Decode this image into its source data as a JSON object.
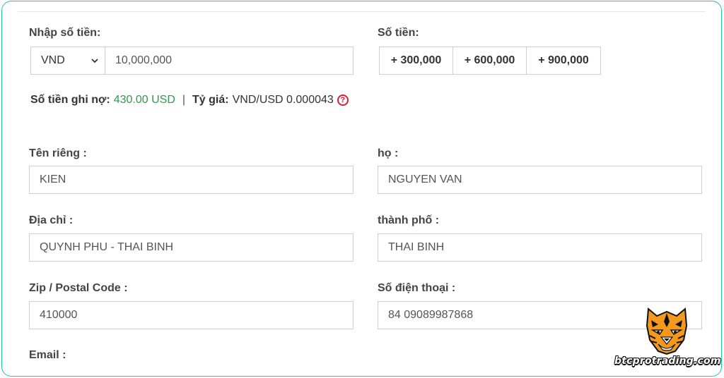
{
  "amount": {
    "label": "Nhập số tiền:",
    "currency": "VND",
    "value": "10,000,000"
  },
  "quick_amounts": {
    "label": "Số tiền:",
    "buttons": [
      "+ 300,000",
      "+ 600,000",
      "+ 900,000"
    ]
  },
  "summary": {
    "debit_label": "Số tiền ghi nợ:",
    "debit_value": "430.00 USD",
    "separator": "|",
    "rate_label": "Tỷ giá:",
    "rate_value": "VND/USD 0.000043",
    "help_icon": "question-circle-icon",
    "help_glyph": "?"
  },
  "form": {
    "first_name": {
      "label": "Tên riêng :",
      "value": "KIEN"
    },
    "last_name": {
      "label": "họ :",
      "value": "NGUYEN VAN"
    },
    "address": {
      "label": "Địa chỉ :",
      "value": "QUYNH PHU - THAI BINH"
    },
    "city": {
      "label": "thành phố :",
      "value": "THAI BINH"
    },
    "zip": {
      "label": "Zip / Postal Code :",
      "value": "410000"
    },
    "phone": {
      "label": "Số điện thoại :",
      "value": "84 09089987868"
    },
    "email": {
      "label": "Email :"
    }
  },
  "watermark": {
    "text": "btcprotrading.com",
    "icon": "tiger-logo-icon"
  },
  "colors": {
    "frame": "#20c0b0",
    "green": "#2e9a4a",
    "help_red": "#d0213a"
  }
}
